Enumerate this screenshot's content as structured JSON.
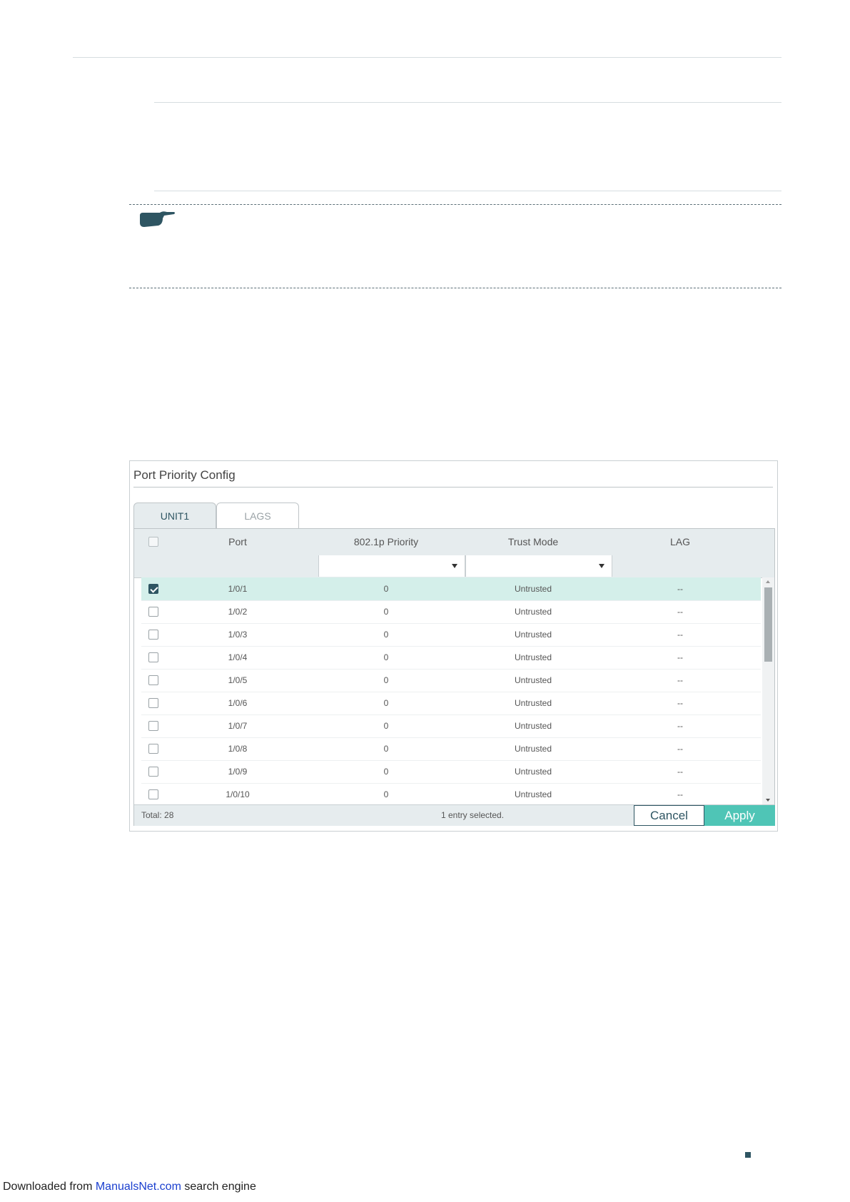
{
  "panel": {
    "title": "Port Priority Config",
    "tabs": [
      {
        "label": "UNIT1",
        "active": true
      },
      {
        "label": "LAGS",
        "active": false
      }
    ],
    "columns": [
      "Port",
      "802.1p Priority",
      "Trust Mode",
      "LAG"
    ],
    "rows": [
      {
        "port": "1/0/1",
        "priority": "0",
        "trust": "Untrusted",
        "lag": "--",
        "checked": true
      },
      {
        "port": "1/0/2",
        "priority": "0",
        "trust": "Untrusted",
        "lag": "--",
        "checked": false
      },
      {
        "port": "1/0/3",
        "priority": "0",
        "trust": "Untrusted",
        "lag": "--",
        "checked": false
      },
      {
        "port": "1/0/4",
        "priority": "0",
        "trust": "Untrusted",
        "lag": "--",
        "checked": false
      },
      {
        "port": "1/0/5",
        "priority": "0",
        "trust": "Untrusted",
        "lag": "--",
        "checked": false
      },
      {
        "port": "1/0/6",
        "priority": "0",
        "trust": "Untrusted",
        "lag": "--",
        "checked": false
      },
      {
        "port": "1/0/7",
        "priority": "0",
        "trust": "Untrusted",
        "lag": "--",
        "checked": false
      },
      {
        "port": "1/0/8",
        "priority": "0",
        "trust": "Untrusted",
        "lag": "--",
        "checked": false
      },
      {
        "port": "1/0/9",
        "priority": "0",
        "trust": "Untrusted",
        "lag": "--",
        "checked": false
      },
      {
        "port": "1/0/10",
        "priority": "0",
        "trust": "Untrusted",
        "lag": "--",
        "checked": false
      }
    ],
    "total": "Total: 28",
    "selection": "1 entry selected.",
    "cancel_label": "Cancel",
    "apply_label": "Apply"
  },
  "colors": {
    "accent": "#2e5562",
    "apply": "#4fc5b6",
    "selected_row": "#d4efea"
  },
  "footer": {
    "prefix": "Downloaded from ",
    "link": "ManualsNet.com",
    "suffix": " search engine"
  }
}
